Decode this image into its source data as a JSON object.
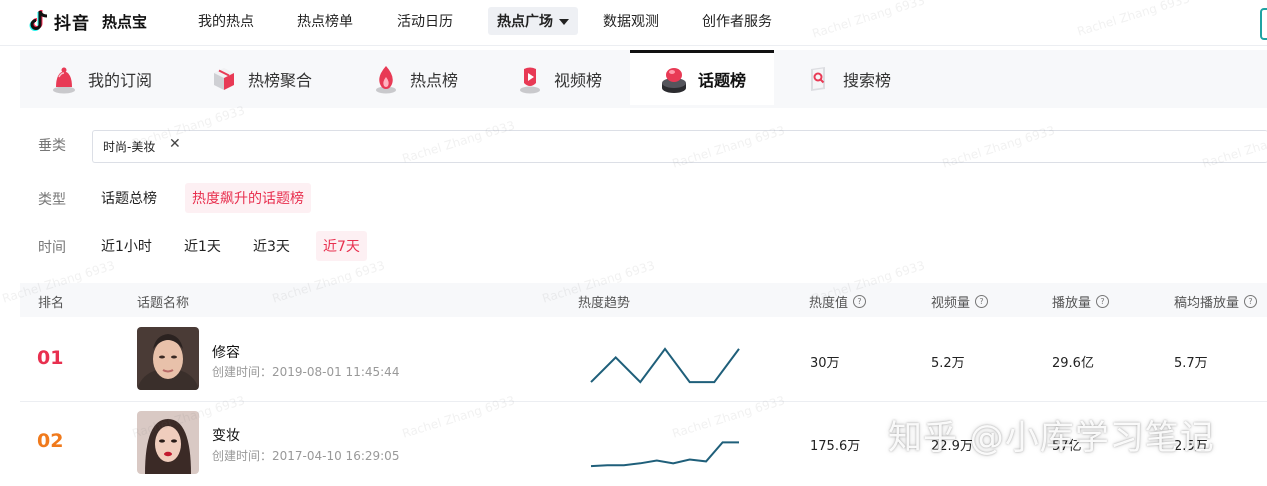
{
  "brand": {
    "name": "抖音",
    "product": "热点宝"
  },
  "topnav": {
    "items": [
      "我的热点",
      "热点榜单",
      "活动日历",
      "热点广场",
      "数据观测",
      "创作者服务"
    ],
    "active": "热点广场"
  },
  "tabs": [
    {
      "label": "我的订阅",
      "icon": "bell-icon"
    },
    {
      "label": "热榜聚合",
      "icon": "cube-icon"
    },
    {
      "label": "热点榜",
      "icon": "flame-icon"
    },
    {
      "label": "视频榜",
      "icon": "video-icon"
    },
    {
      "label": "话题榜",
      "icon": "topic-button-icon"
    },
    {
      "label": "搜索榜",
      "icon": "search-book-icon"
    }
  ],
  "active_tab": "话题榜",
  "filters": {
    "vertical": {
      "label": "垂类",
      "selected": "时尚-美妆"
    },
    "type": {
      "label": "类型",
      "options": [
        "话题总榜",
        "热度飙升的话题榜"
      ],
      "active": "热度飙升的话题榜"
    },
    "time": {
      "label": "时间",
      "options": [
        "近1小时",
        "近1天",
        "近3天",
        "近7天"
      ],
      "active": "近7天"
    }
  },
  "table": {
    "headers": {
      "rank": "排名",
      "name": "话题名称",
      "trend": "热度趋势",
      "heat": "热度值",
      "videos": "视频量",
      "plays": "播放量",
      "avg_plays": "稿均播放量"
    },
    "rows": [
      {
        "rank": "01",
        "name": "修容",
        "created": "创建时间：2019-08-01 11:45:44",
        "heat": "30万",
        "videos": "5.2万",
        "plays": "29.6亿",
        "avg_plays": "5.7万",
        "trend": [
          2,
          28,
          2,
          37,
          2,
          2,
          37
        ],
        "rank_color": "#e8304f"
      },
      {
        "rank": "02",
        "name": "变妆",
        "created": "创建时间：2017-04-10 16:29:05",
        "heat": "175.6万",
        "videos": "22.9万",
        "plays": "57亿",
        "avg_plays": "2.5万",
        "trend": [
          3,
          4,
          4,
          6,
          9,
          6,
          10,
          8,
          28,
          28
        ],
        "rank_color": "#f07a1c"
      }
    ]
  },
  "watermark": "Rachel Zhang 6933",
  "overlay_watermark": "知乎 @小库学习笔记",
  "colors": {
    "accent": "#e8304f",
    "trend_line": "#1f5f7a"
  }
}
